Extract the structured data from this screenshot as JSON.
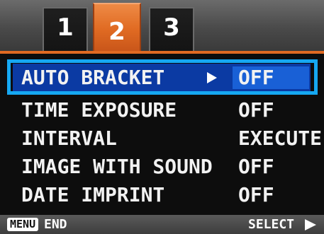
{
  "tabs": [
    {
      "label": "1",
      "active": false
    },
    {
      "label": "2",
      "active": true
    },
    {
      "label": "3",
      "active": false
    }
  ],
  "menu": {
    "items": [
      {
        "label": "AUTO BRACKET",
        "value": "OFF",
        "selected": true
      },
      {
        "label": "TIME EXPOSURE",
        "value": "OFF",
        "selected": false
      },
      {
        "label": "INTERVAL",
        "value": "EXECUTE",
        "selected": false
      },
      {
        "label": "IMAGE WITH SOUND",
        "value": "OFF",
        "selected": false
      },
      {
        "label": "DATE IMPRINT",
        "value": "OFF",
        "selected": false
      }
    ]
  },
  "footer": {
    "menu_key": "MENU",
    "end_label": "END",
    "select_label": "SELECT"
  },
  "icons": {
    "selected_row_arrow": "arrow-right-icon",
    "select_arrow": "arrow-right-icon"
  },
  "colors": {
    "active_tab": "#e06a22",
    "selection_border": "#16a8f2",
    "selection_fill": "#0b3aa3",
    "selection_value_fill": "#1960d6",
    "panel_background": "#0d0d0d"
  }
}
